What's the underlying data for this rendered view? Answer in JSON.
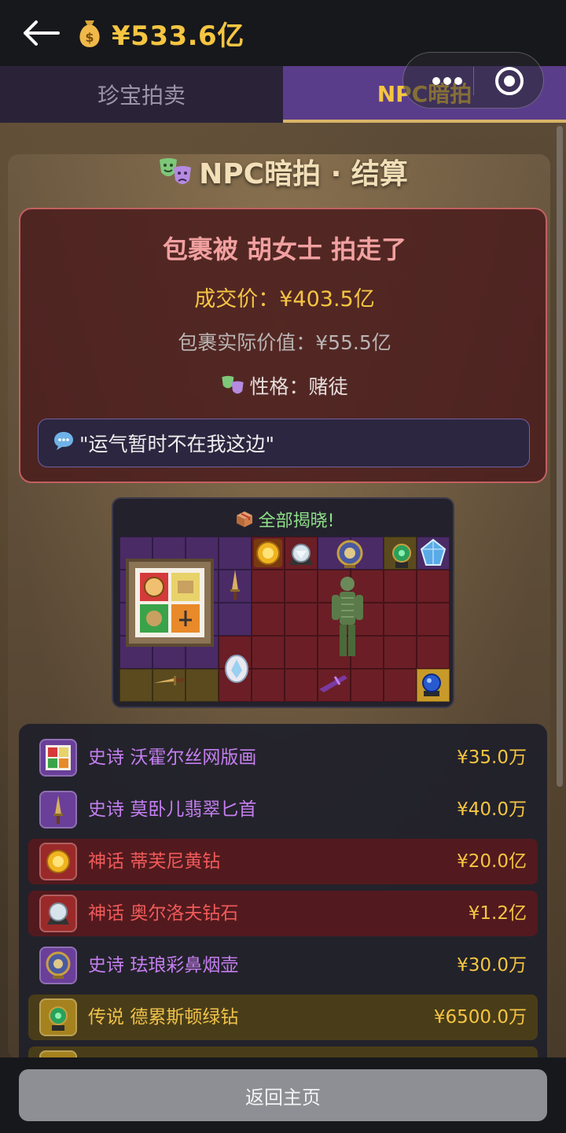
{
  "header": {
    "back_icon": "arrow-left-icon",
    "money_icon": "money-bag-icon",
    "balance": "¥533.6亿"
  },
  "tabs": [
    {
      "label": "珍宝拍卖",
      "active": false
    },
    {
      "label": "NPC暗拍",
      "active": true
    }
  ],
  "capsule": {
    "more_icon": "more-dots-icon",
    "close_icon": "target-circle-icon"
  },
  "settlement": {
    "title": "NPC暗拍 · 结算",
    "title_icon": "theater-masks-icon",
    "result_text": "包裹被 胡女士 拍走了",
    "deal_price": "成交价：¥403.5亿",
    "real_value": "包裹实际价值：¥55.5亿",
    "personality": "性格：赌徒",
    "quote": "\"运气暂时不在我这边\"",
    "quote_icon": "speech-bubble-icon"
  },
  "reveal": {
    "title": "全部揭晓!",
    "title_icon": "package-box-icon"
  },
  "items": [
    {
      "rarity": "史诗",
      "name": "沃霍尔丝网版画",
      "price": "¥35.0万",
      "tier": "epic"
    },
    {
      "rarity": "史诗",
      "name": "莫卧儿翡翠匕首",
      "price": "¥40.0万",
      "tier": "epic"
    },
    {
      "rarity": "神话",
      "name": "蒂芙尼黄钻",
      "price": "¥20.0亿",
      "tier": "myth"
    },
    {
      "rarity": "神话",
      "name": "奥尔洛夫钻石",
      "price": "¥1.2亿",
      "tier": "myth"
    },
    {
      "rarity": "史诗",
      "name": "珐琅彩鼻烟壶",
      "price": "¥30.0万",
      "tier": "epic"
    },
    {
      "rarity": "传说",
      "name": "德累斯顿绿钻",
      "price": "¥6500.0万",
      "tier": "legend"
    }
  ],
  "footer": {
    "home_button": "返回主页"
  },
  "colors": {
    "gold": "#f5c542",
    "epic": "#c57ff0",
    "myth": "#f05a5a",
    "legend": "#f0c24a",
    "tab_active": "#5a3d8a"
  }
}
